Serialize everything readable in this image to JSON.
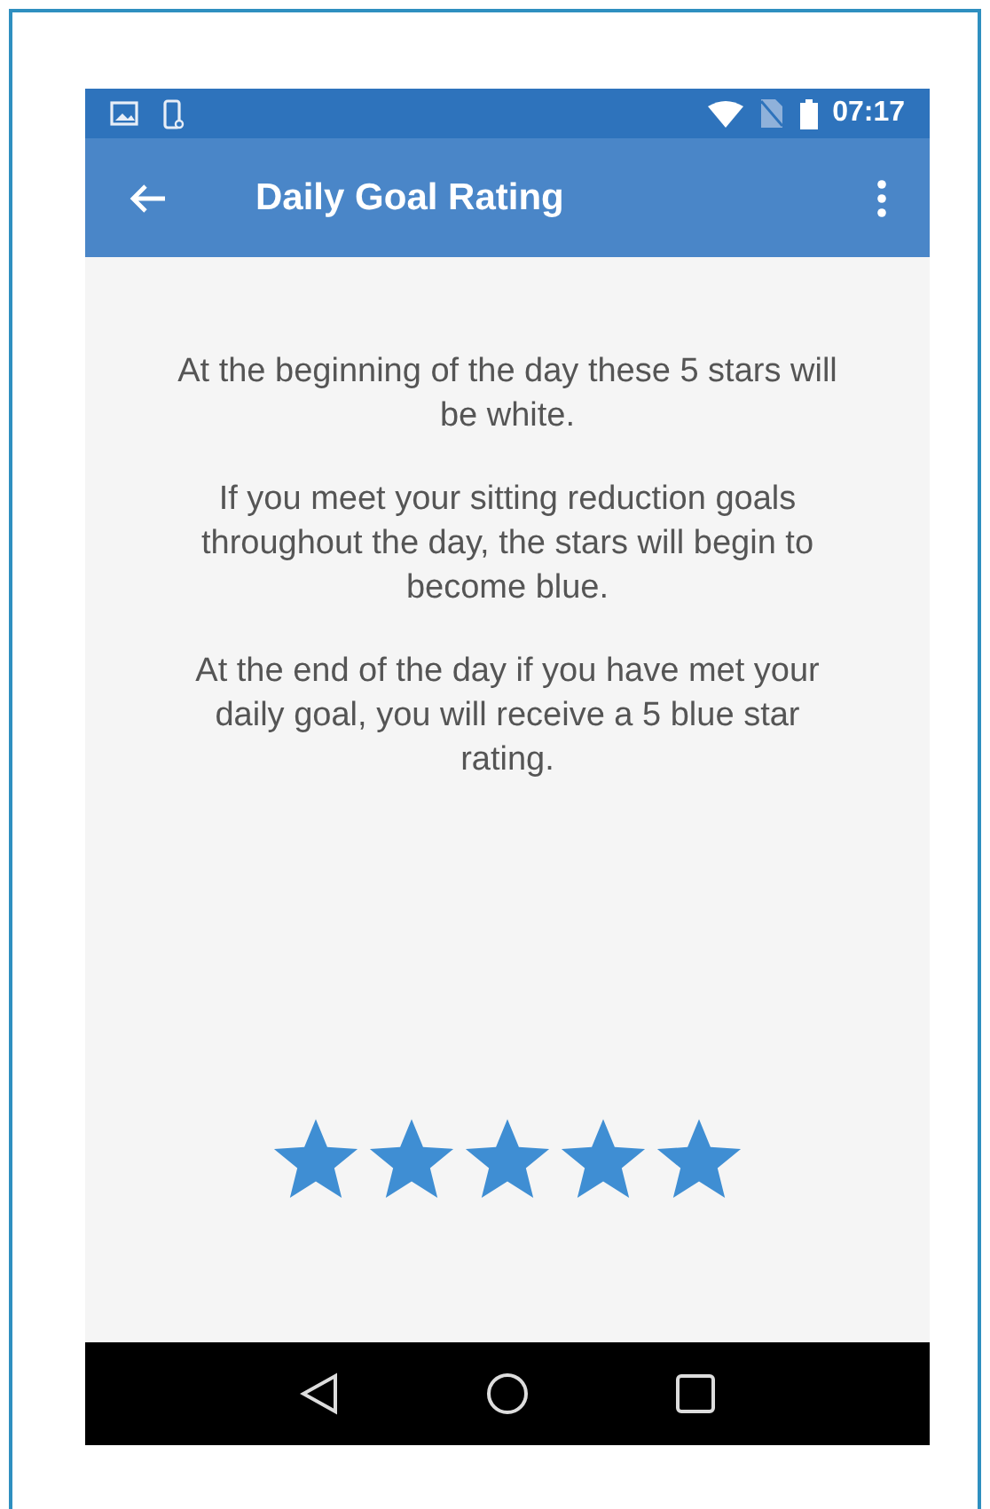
{
  "status_bar": {
    "time": "07:17"
  },
  "toolbar": {
    "title": "Daily Goal Rating"
  },
  "paragraphs": [
    "At the beginning of the day these 5 stars will be white.",
    "If you meet your sitting reduction goals throughout the day, the stars will begin to become blue.",
    "At the end of the day if you have met your daily goal, you will receive a 5 blue star rating."
  ],
  "rating": {
    "stars": 5
  }
}
